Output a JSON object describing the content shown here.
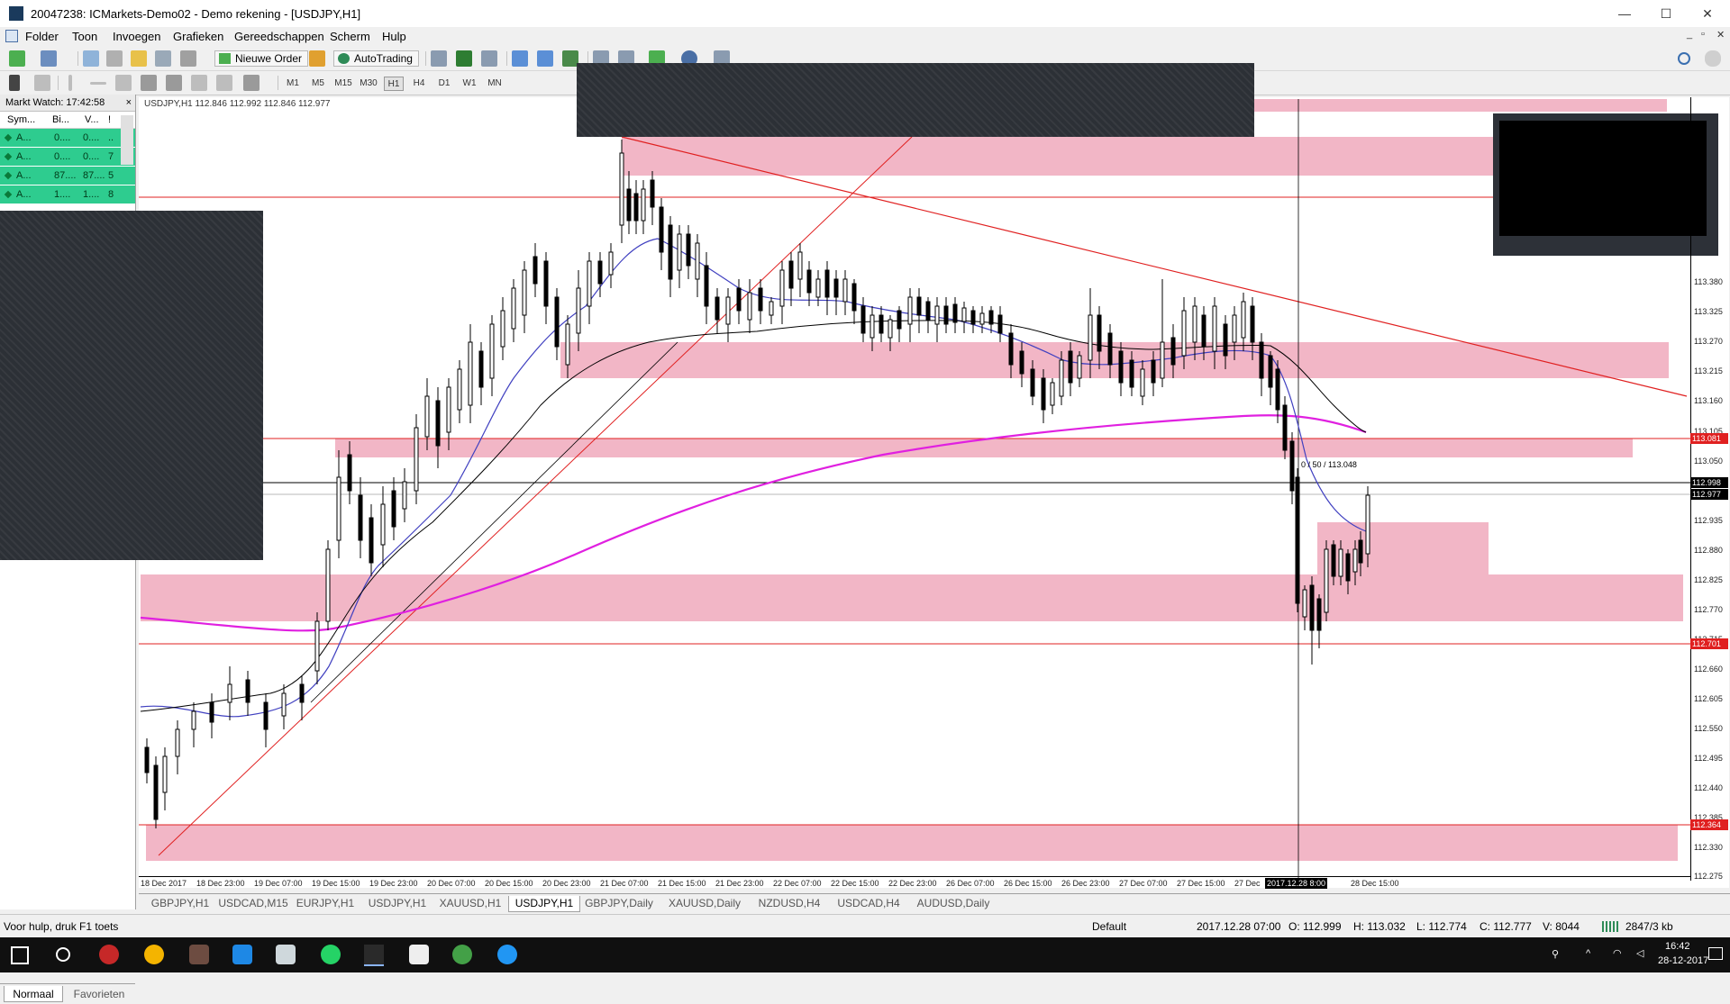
{
  "window": {
    "title": "20047238: ICMarkets-Demo02 - Demo rekening - [USDJPY,H1]",
    "controls": [
      "—",
      "☐",
      "✕"
    ]
  },
  "menu": {
    "items": [
      "Folder",
      "Toon",
      "Invoegen",
      "Grafieken",
      "Gereedschappen",
      "Scherm",
      "Hulp"
    ],
    "mdi": [
      "_",
      "▫",
      "✕"
    ]
  },
  "toolbar": {
    "new_order": "Nieuwe Order",
    "autotrading": "AutoTrading",
    "timeframes": [
      "M1",
      "M5",
      "M15",
      "M30",
      "H1",
      "H4",
      "D1",
      "W1",
      "MN"
    ],
    "active_timeframe": "H1"
  },
  "market_watch": {
    "title": "Markt Watch: 17:42:58",
    "close": "×",
    "columns": [
      "Sym...",
      "Bi...",
      "V...",
      "!"
    ],
    "rows": [
      {
        "symbol": "A...",
        "bid": "0....",
        "ask": "0....",
        "extra": ".."
      },
      {
        "symbol": "A...",
        "bid": "0....",
        "ask": "0....",
        "extra": "7"
      },
      {
        "symbol": "A...",
        "bid": "87....",
        "ask": "87....",
        "extra": "5"
      },
      {
        "symbol": "A...",
        "bid": "1....",
        "ask": "1....",
        "extra": "8"
      }
    ],
    "tabs": [
      "Normaal",
      "Favorieten"
    ]
  },
  "chart": {
    "title": "USDJPY,H1  112.846 112.992 112.846 112.977",
    "fib_label": "0 / 50 / 113.048",
    "colors": {
      "zone": "#f2b6c6",
      "level": "#e02020",
      "ma200": "#e020e0",
      "ma_fast": "#4040c0",
      "ma_slow": "#000000",
      "trend": "#e02020"
    },
    "price_axis": [
      "113.380",
      "113.325",
      "113.270",
      "113.215",
      "113.160",
      "113.105",
      "113.050",
      "112.935",
      "112.880",
      "112.825",
      "112.770",
      "112.715",
      "112.660",
      "112.605",
      "112.550",
      "112.495",
      "112.440",
      "112.385",
      "112.330",
      "112.275"
    ],
    "price_tags": [
      {
        "value": "113.081",
        "color": "#e02020"
      },
      {
        "value": "112.998",
        "color": "#000000"
      },
      {
        "value": "112.977",
        "color": "#000000"
      },
      {
        "value": "112.701",
        "color": "#e02020"
      },
      {
        "value": "112.364",
        "color": "#e02020"
      }
    ],
    "time_axis": [
      "18 Dec 2017",
      "18 Dec 23:00",
      "19 Dec 07:00",
      "19 Dec 15:00",
      "19 Dec 23:00",
      "20 Dec 07:00",
      "20 Dec 15:00",
      "20 Dec 23:00",
      "21 Dec 07:00",
      "21 Dec 15:00",
      "21 Dec 23:00",
      "22 Dec 07:00",
      "22 Dec 15:00",
      "22 Dec 23:00",
      "26 Dec 07:00",
      "26 Dec 15:00",
      "26 Dec 23:00",
      "27 Dec 07:00",
      "27 Dec 15:00",
      "27 Dec",
      "28 Dec 15:00"
    ],
    "crosshair_time": "2017.12.28 8:00"
  },
  "chart_tabs": {
    "items": [
      "GBPJPY,H1",
      "USDCAD,M15",
      "EURJPY,H1",
      "USDJPY,H1",
      "XAUUSD,H1",
      "USDJPY,H1",
      "GBPJPY,Daily",
      "XAUUSD,Daily",
      "NZDUSD,H4",
      "USDCAD,H4",
      "AUDUSD,Daily"
    ],
    "active_index": 5
  },
  "status": {
    "help": "Voor hulp, druk F1 toets",
    "profile": "Default",
    "datetime": "2017.12.28 07:00",
    "open": "O: 112.999",
    "high": "H: 113.032",
    "low": "L: 112.774",
    "close": "C: 112.777",
    "volume": "V: 8044",
    "traffic": "2847/3 kb"
  },
  "taskbar": {
    "time": "16:42",
    "date": "28-12-2017"
  }
}
